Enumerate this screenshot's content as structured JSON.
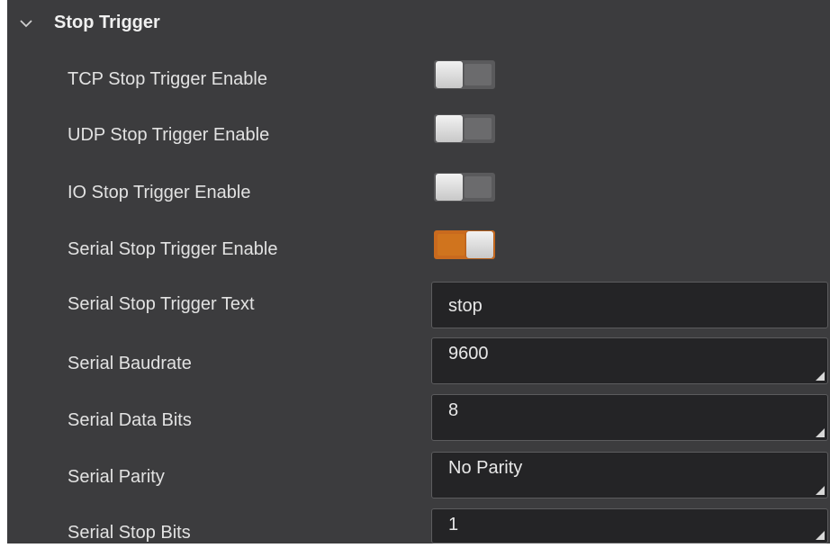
{
  "section": {
    "title": "Stop Trigger",
    "chevron_icon": "chevron-down-icon"
  },
  "toggles": [
    {
      "label": "TCP Stop Trigger Enable",
      "enabled": false
    },
    {
      "label": "UDP Stop Trigger Enable",
      "enabled": false
    },
    {
      "label": "IO Stop Trigger Enable",
      "enabled": false
    },
    {
      "label": "Serial Stop Trigger Enable",
      "enabled": true
    }
  ],
  "text_field": {
    "label": "Serial Stop Trigger Text",
    "value": "stop"
  },
  "selects": [
    {
      "label": "Serial Baudrate",
      "value": "9600"
    },
    {
      "label": "Serial Data Bits",
      "value": "8"
    },
    {
      "label": "Serial Parity",
      "value": "No Parity"
    },
    {
      "label": "Serial Stop Bits",
      "value": "1"
    }
  ],
  "colors": {
    "panel_bg": "#3c3c3e",
    "toggle_on": "#c96a1e",
    "toggle_off": "#5a5a5c",
    "field_bg": "#242426"
  }
}
